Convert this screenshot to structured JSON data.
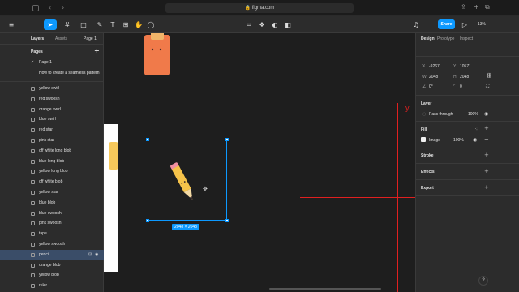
{
  "browser": {
    "url": "figma.com",
    "back_glyph": "‹",
    "forward_glyph": "›",
    "share_glyph": "⇪",
    "newtab_glyph": "+",
    "tabs_glyph": "⧉"
  },
  "toolbar": {
    "share_label": "Share",
    "zoom": "13%",
    "avatar_initial": "K",
    "play_glyph": "▷"
  },
  "left_panel": {
    "tabs": [
      "Layers",
      "Assets"
    ],
    "page_selector": "Page 1",
    "pages_title": "Pages",
    "pages": [
      {
        "name": "Page 1",
        "current": true
      },
      {
        "name": "How to create a seamless pattern",
        "current": false
      }
    ],
    "layers": [
      {
        "name": "yellow swirl",
        "selected": false
      },
      {
        "name": "red swoosh",
        "selected": false
      },
      {
        "name": "orange swirl",
        "selected": false
      },
      {
        "name": "blue swirl",
        "selected": false
      },
      {
        "name": "red star",
        "selected": false
      },
      {
        "name": "pink star",
        "selected": false
      },
      {
        "name": "off white long blob",
        "selected": false
      },
      {
        "name": "blue long blob",
        "selected": false
      },
      {
        "name": "yellow long blob",
        "selected": false
      },
      {
        "name": "off white blob",
        "selected": false
      },
      {
        "name": "yellow star",
        "selected": false
      },
      {
        "name": "blue blob",
        "selected": false
      },
      {
        "name": "blue swoosh",
        "selected": false
      },
      {
        "name": "pink swoosh",
        "selected": false
      },
      {
        "name": "tape",
        "selected": false
      },
      {
        "name": "yellow swoosh",
        "selected": false
      },
      {
        "name": "pencil",
        "selected": true
      },
      {
        "name": "orange blob",
        "selected": false
      },
      {
        "name": "yellow blob",
        "selected": false
      },
      {
        "name": "ruler",
        "selected": false
      }
    ]
  },
  "canvas": {
    "selection_size": "2048 × 2048",
    "guide_label": "y"
  },
  "right_panel": {
    "tabs": [
      "Design",
      "Prototype",
      "Inspect"
    ],
    "x_label": "X",
    "x_value": "-9267",
    "y_label": "Y",
    "y_value": "10571",
    "w_label": "W",
    "w_value": "2048",
    "h_label": "H",
    "h_value": "2048",
    "rotation": "0°",
    "radius": "0",
    "layer_title": "Layer",
    "blend_mode": "Pass through",
    "layer_opacity": "100%",
    "fill_title": "Fill",
    "fill_type": "Image",
    "fill_opacity": "100%",
    "stroke_title": "Stroke",
    "effects_title": "Effects",
    "export_title": "Export"
  },
  "help_glyph": "?"
}
